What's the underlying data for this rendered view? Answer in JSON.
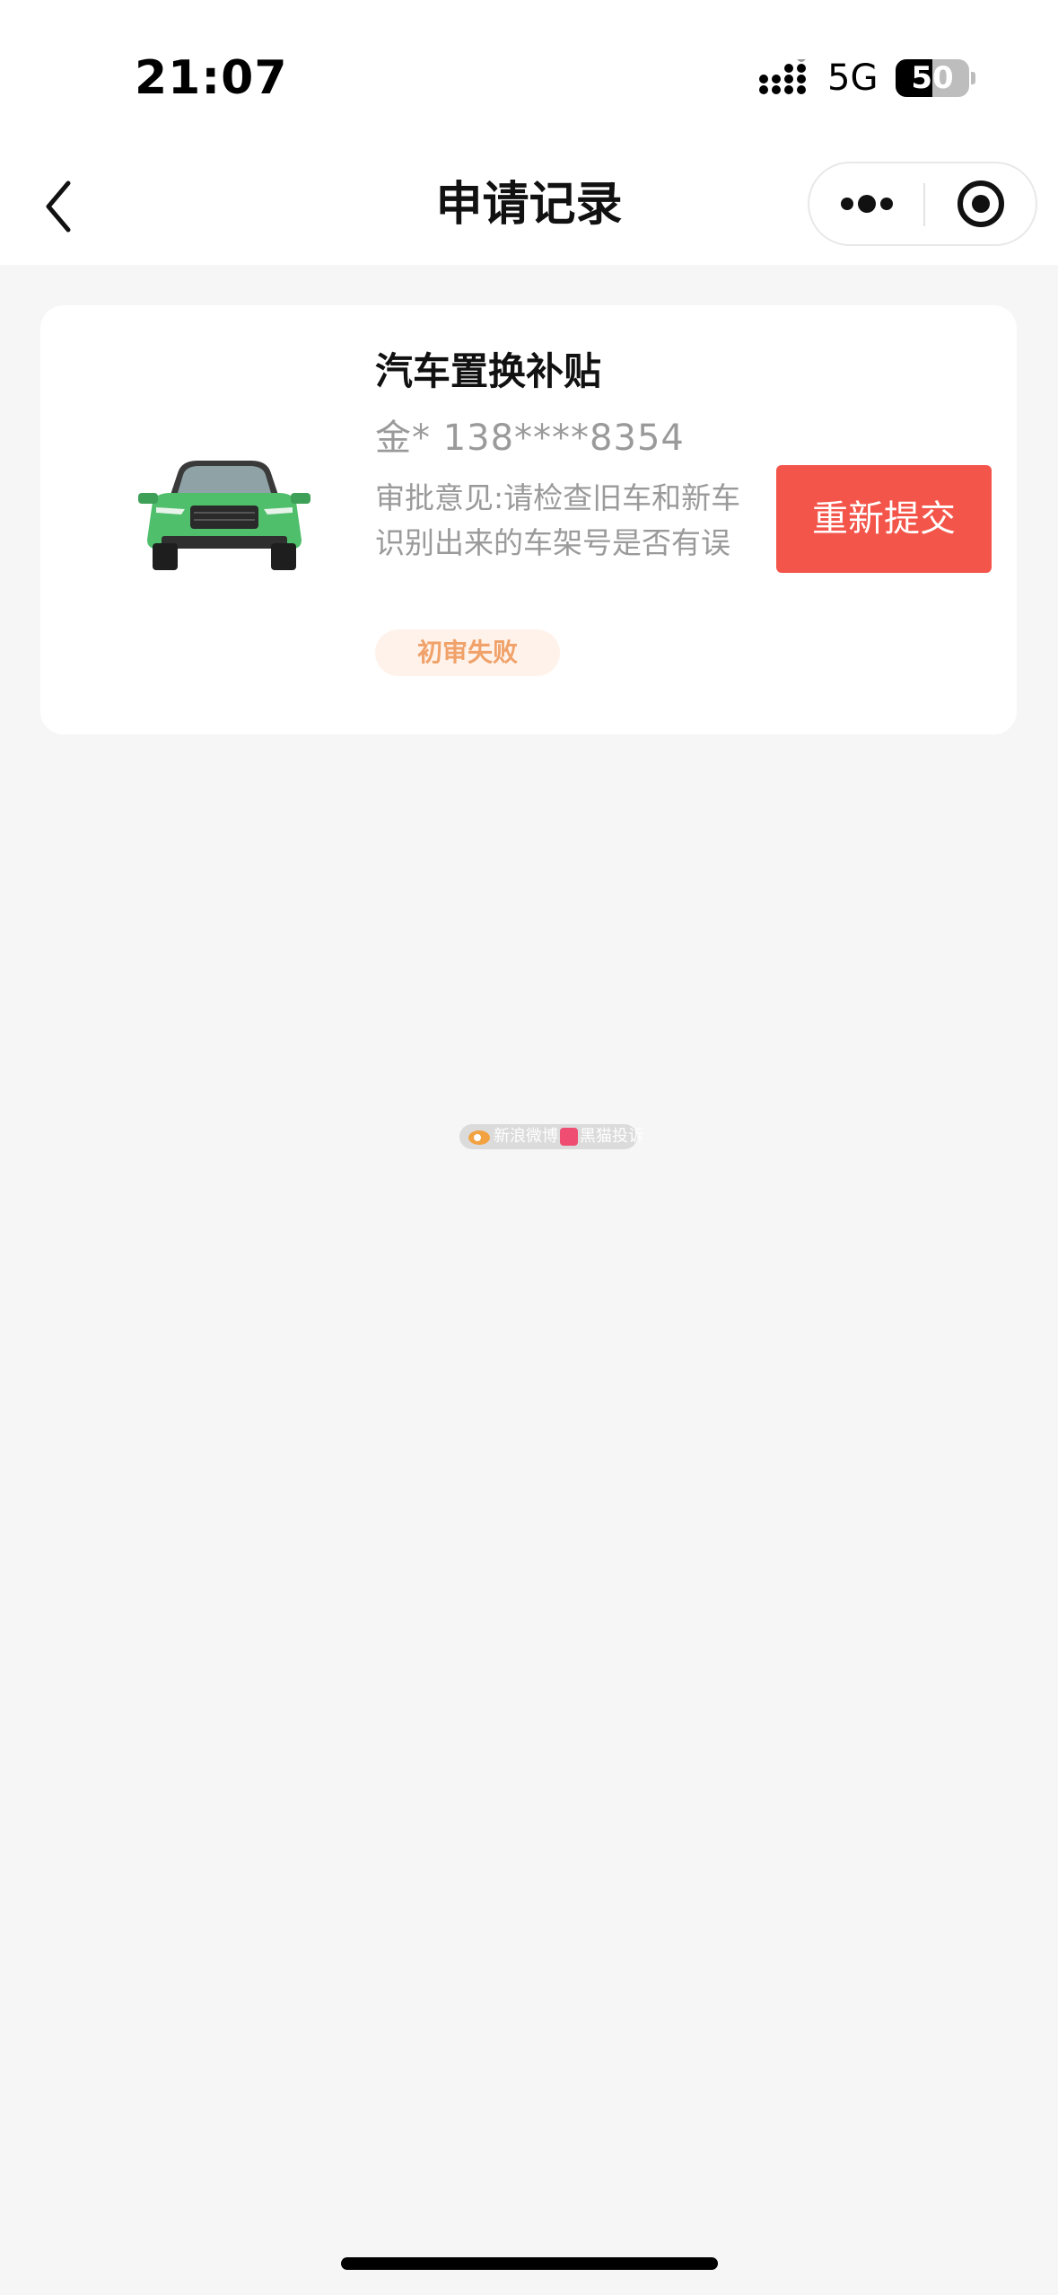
{
  "status_bar": {
    "time": "21:07",
    "network": "5G",
    "battery_level": "50",
    "battery_fraction": 0.5
  },
  "nav": {
    "title": "申请记录",
    "back_icon": "chevron-left-icon",
    "more_icon": "more-dots-icon",
    "close_icon": "target-circle-icon"
  },
  "records": [
    {
      "title": "汽车置换补贴",
      "applicant": "金* 138****8354",
      "opinion": "审批意见:请检查旧车和新车识别出来的车架号是否有误",
      "status": "初审失败",
      "action_label": "重新提交",
      "car_image": "green-suv-front",
      "car_color": "#4fbf6b"
    }
  ],
  "watermark": {
    "brand_1": "新浪微博",
    "brand_2": "黑猫投诉"
  },
  "colors": {
    "accent_button": "#f4554a",
    "status_text": "#f0a26a",
    "status_bg": "#fff2ea",
    "page_bg": "#f6f6f6"
  }
}
